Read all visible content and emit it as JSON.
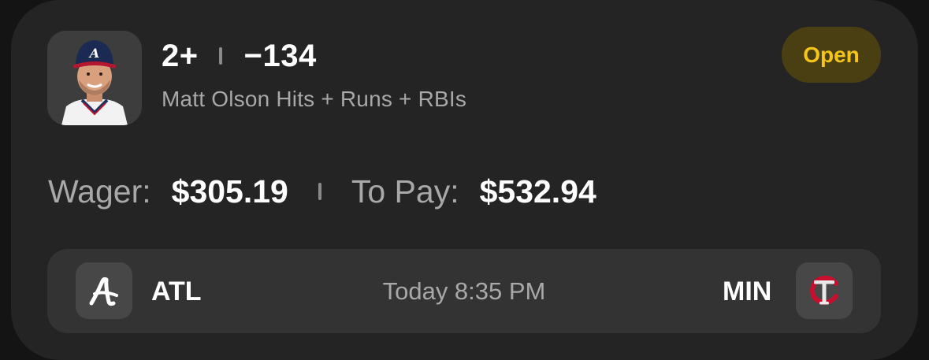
{
  "bet": {
    "line": "2+",
    "odds": "−134",
    "market": "Matt Olson Hits + Runs + RBIs",
    "status": "Open"
  },
  "payout": {
    "wager_label": "Wager:",
    "wager_amount": "$305.19",
    "to_pay_label": "To Pay:",
    "to_pay_amount": "$532.94"
  },
  "game": {
    "home_team": "ATL",
    "away_team": "MIN",
    "time": "Today 8:35 PM",
    "home_logo_icon": "braves-a-logo-icon",
    "away_logo_icon": "twins-tc-logo-icon"
  },
  "colors": {
    "status_text": "#f5c518",
    "status_bg": "#4a3f12",
    "card_bg": "#242424"
  }
}
